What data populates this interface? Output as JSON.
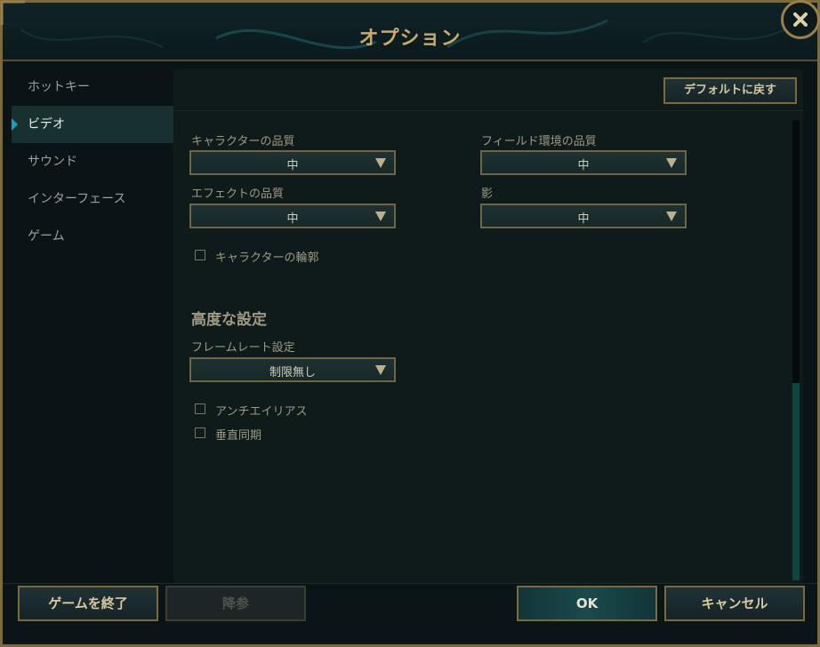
{
  "window": {
    "title": "オプション"
  },
  "sidebar": {
    "items": [
      {
        "label": "ホットキー",
        "active": false
      },
      {
        "label": "ビデオ",
        "active": true
      },
      {
        "label": "サウンド",
        "active": false
      },
      {
        "label": "インターフェース",
        "active": false
      },
      {
        "label": "ゲーム",
        "active": false
      }
    ]
  },
  "panel": {
    "default_button": "デフォルトに戻す",
    "character_quality": {
      "label": "キャラクターの品質",
      "value": "中"
    },
    "environment_quality": {
      "label": "フィールド環境の品質",
      "value": "中"
    },
    "effects_quality": {
      "label": "エフェクトの品質",
      "value": "中"
    },
    "shadows": {
      "label": "影",
      "value": "中"
    },
    "character_outline": {
      "label": "キャラクターの輪郭",
      "checked": false
    },
    "advanced": {
      "title": "高度な設定",
      "frame_rate": {
        "label": "フレームレート設定",
        "value": "制限無し"
      },
      "anti_aliasing": {
        "label": "アンチエイリアス",
        "checked": false
      },
      "vsync": {
        "label": "垂直同期",
        "checked": false
      }
    }
  },
  "footer": {
    "quit_game": "ゲームを終了",
    "surrender": "降参",
    "ok": "OK",
    "cancel": "キャンセル"
  },
  "colors": {
    "gold": "#c8aa6e",
    "frame": "#7d6a3a",
    "accent_blue": "#0fa5c0",
    "scroll_thumb": "#0c463e"
  },
  "icons": {
    "close": "close-x-icon",
    "dropdown": "triangle-down-icon",
    "selected": "arrow-right-icon"
  }
}
